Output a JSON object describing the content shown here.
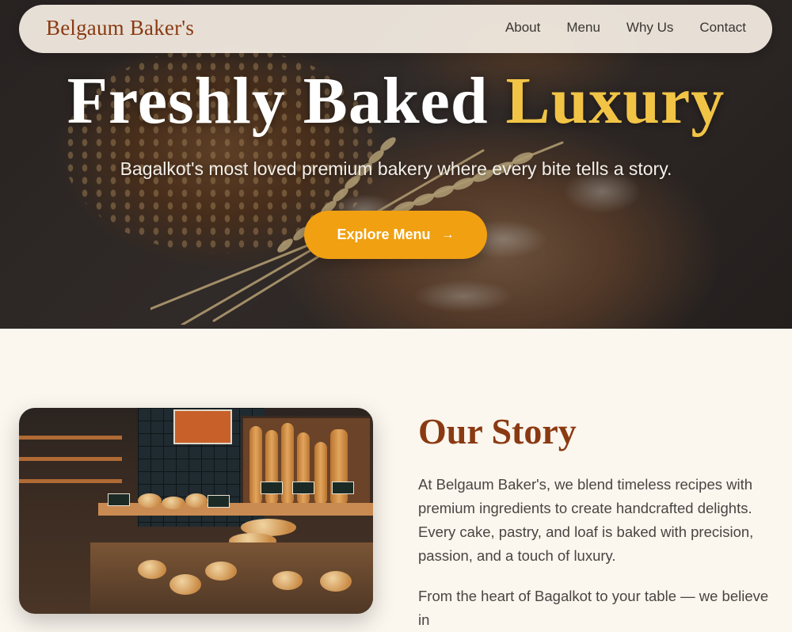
{
  "nav": {
    "brand": "Belgaum Baker's",
    "links": [
      "About",
      "Menu",
      "Why Us",
      "Contact"
    ]
  },
  "hero": {
    "title_main": "Freshly Baked",
    "title_accent": "Luxury",
    "subtitle": "Bagalkot's most loved premium bakery where every bite tells a story.",
    "cta_label": "Explore Menu",
    "cta_icon": "→"
  },
  "story": {
    "heading": "Our Story",
    "paragraph_1": "At Belgaum Baker's, we blend timeless recipes with premium ingredients to create handcrafted delights. Every cake, pastry, and loaf is baked with precision, passion, and a touch of luxury.",
    "paragraph_2": "From the heart of Bagalkot to your table — we believe in"
  },
  "colors": {
    "brand": "#8a3a12",
    "accent": "#f2c446",
    "cta": "#f0a011",
    "page_bg": "#fbf6ee"
  }
}
